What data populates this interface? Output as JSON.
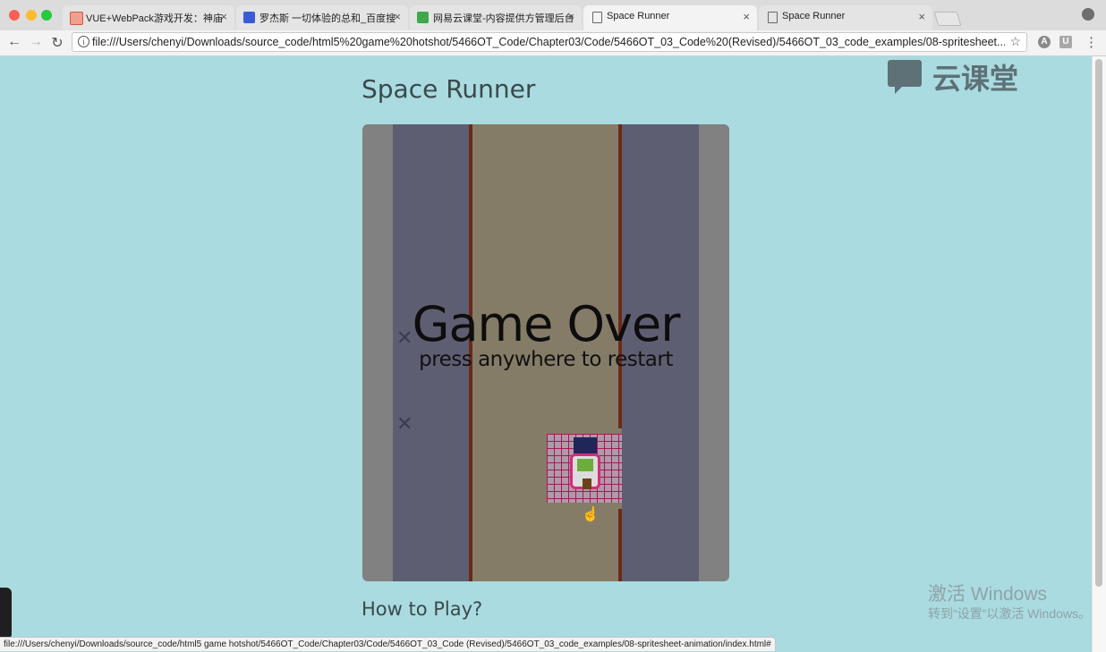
{
  "tabs": [
    {
      "title": "VUE+WebPack游戏开发：神庙",
      "favicon": "orange-square-icon"
    },
    {
      "title": "罗杰斯 一切体验的总和_百度搜",
      "favicon": "baidu-paw-icon"
    },
    {
      "title": "网易云课堂-内容提供方管理后台",
      "favicon": "green-folder-icon"
    },
    {
      "title": "Space Runner",
      "favicon": "document-icon"
    },
    {
      "title": "Space Runner",
      "favicon": "document-icon"
    }
  ],
  "toolbar": {
    "back_icon": "←",
    "forward_icon": "→",
    "reload_icon": "↻",
    "url": "file:///Users/chenyi/Downloads/source_code/html5%20game%20hotshot/5466OT_Code/Chapter03/Code/5466OT_03_Code%20(Revised)/5466OT_03_code_examples/08-spritesheet...",
    "info_icon": "i",
    "star_icon": "☆",
    "ext1_label": "A",
    "ext2_label": "U",
    "menu_icon": "⋮"
  },
  "page": {
    "title": "Space Runner",
    "how_to_play": "How to Play?",
    "logo_text": "云课堂"
  },
  "game": {
    "game_over": "Game Over",
    "restart_hint": "press anywhere to restart",
    "scratch_glyph": "✕",
    "cursor_glyph": "☝"
  },
  "overlay": {
    "watermark_line1": "激活 Windows",
    "watermark_line2": "转到“设置”以激活 Windows。",
    "status_url": "file:///Users/chenyi/Downloads/source_code/html5 game hotshot/5466OT_Code/Chapter03/Code/5466OT_03_Code (Revised)/5466OT_03_code_examples/08-spritesheet-animation/index.html#"
  },
  "tab_close_glyph": "×",
  "colors": {
    "page_bg": "#a9dbe0",
    "road": "#857c68",
    "side_lanes": "#5e5e73",
    "rails": "#6b2a19",
    "sprite_grid": "#a3195a"
  }
}
